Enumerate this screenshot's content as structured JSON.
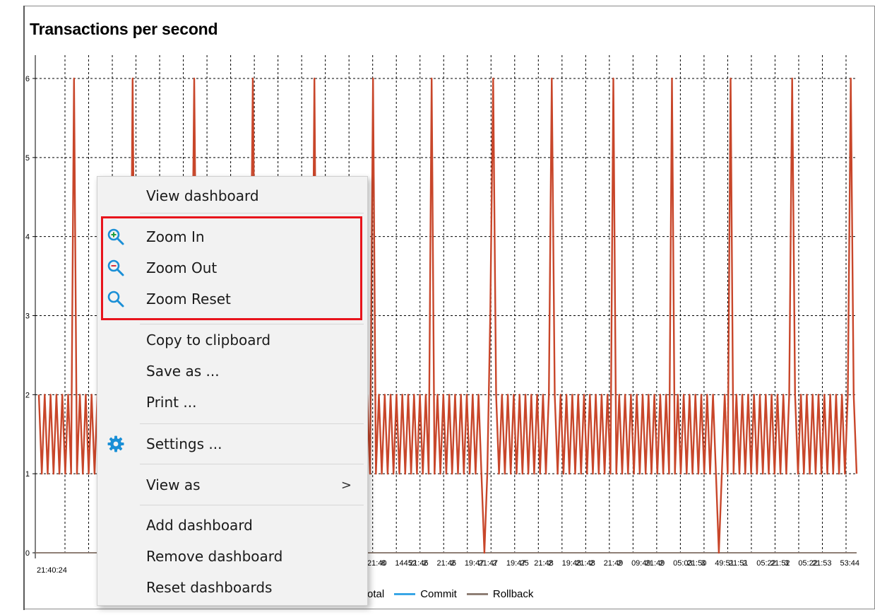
{
  "chart_data": {
    "type": "line",
    "title": "Transactions per second",
    "yticks": [
      "0",
      "1",
      "2",
      "3",
      "4",
      "5",
      "6"
    ],
    "ylim": [
      0,
      6
    ],
    "grid": true,
    "x_start_label": "21:40:24",
    "x_tick_labels_visible": [
      "21:40:24",
      "21:40",
      "8",
      "14452",
      "21:46",
      "2",
      "21:46",
      "2",
      "19:47",
      "21:47",
      "2",
      "19:47",
      "25",
      "21:48",
      "2",
      "19:48",
      "21:48",
      "2",
      "21:49",
      "2",
      "09:49",
      "21:49",
      "2",
      "05:03",
      "21:50",
      "3",
      "49:51",
      "21:51",
      "2",
      "05:22",
      "21:52",
      "3",
      "05:22",
      "21:53",
      "21:53:44"
    ],
    "x_last_label": "53:44",
    "series": [
      {
        "name": "Total",
        "color": "#c8462a",
        "pattern": "oscillates between 1 and 2 each tick, spikes to 6 periodically, drops to 0 twice",
        "spike_count": 14,
        "spike_value": 6,
        "baseline_low": 1,
        "baseline_high": 2,
        "dips_to_zero": 2,
        "partial_spike_value": 3
      },
      {
        "name": "Commit",
        "color": "#3aa6e6"
      },
      {
        "name": "Rollback",
        "color": "#8f7f76"
      }
    ],
    "legend": [
      "Total",
      "Commit",
      "Rollback"
    ],
    "legend_visible_text": [
      "otal",
      "Commit",
      "Rollback"
    ],
    "legend_placement": "bottom-center"
  },
  "context_menu": {
    "items": [
      {
        "id": "view-dashboard",
        "label": "View dashboard",
        "icon": null
      },
      {
        "id": "zoom-in",
        "label": "Zoom In",
        "icon": "zoom-in-icon"
      },
      {
        "id": "zoom-out",
        "label": "Zoom Out",
        "icon": "zoom-out-icon"
      },
      {
        "id": "zoom-reset",
        "label": "Zoom Reset",
        "icon": "zoom-reset-icon"
      },
      {
        "id": "copy-to-clipboard",
        "label": "Copy to clipboard",
        "icon": null
      },
      {
        "id": "save-as",
        "label": "Save as ...",
        "icon": null
      },
      {
        "id": "print",
        "label": "Print ...",
        "icon": null
      },
      {
        "id": "settings",
        "label": "Settings ...",
        "icon": "gear-icon"
      },
      {
        "id": "view-as",
        "label": "View as",
        "icon": null,
        "submenu_arrow": ">"
      },
      {
        "id": "add-dashboard",
        "label": "Add dashboard",
        "icon": null
      },
      {
        "id": "remove-dashboard",
        "label": "Remove dashboard",
        "icon": null
      },
      {
        "id": "reset-dashboards",
        "label": "Reset dashboards",
        "icon": null
      }
    ],
    "highlighted_group": [
      "Zoom In",
      "Zoom Out",
      "Zoom Reset"
    ],
    "highlight_color": "#e8141c"
  },
  "colors": {
    "series_line": "#c8462a",
    "icon_blue": "#1a8fd6",
    "menu_bg": "#f2f2f2"
  }
}
